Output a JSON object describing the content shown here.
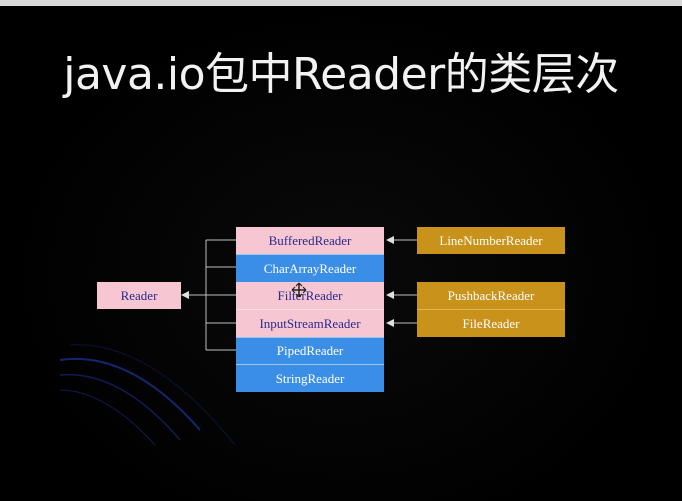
{
  "title": "java.io包中Reader的类层次",
  "diagram": {
    "base": "Reader",
    "subclasses": [
      "BufferedReader",
      "CharArrayReader",
      "FilterReader",
      "InputStreamReader",
      "PipedReader",
      "StringReader"
    ],
    "extensions": [
      {
        "name": "LineNumberReader",
        "extends": "BufferedReader"
      },
      {
        "name": "PushbackReader",
        "extends": "FilterReader"
      },
      {
        "name": "FileReader",
        "extends": "InputStreamReader"
      }
    ],
    "colors": {
      "abstract": "#f6c6d2",
      "concrete": "#3b8ee6",
      "extension": "#c9921a"
    }
  }
}
